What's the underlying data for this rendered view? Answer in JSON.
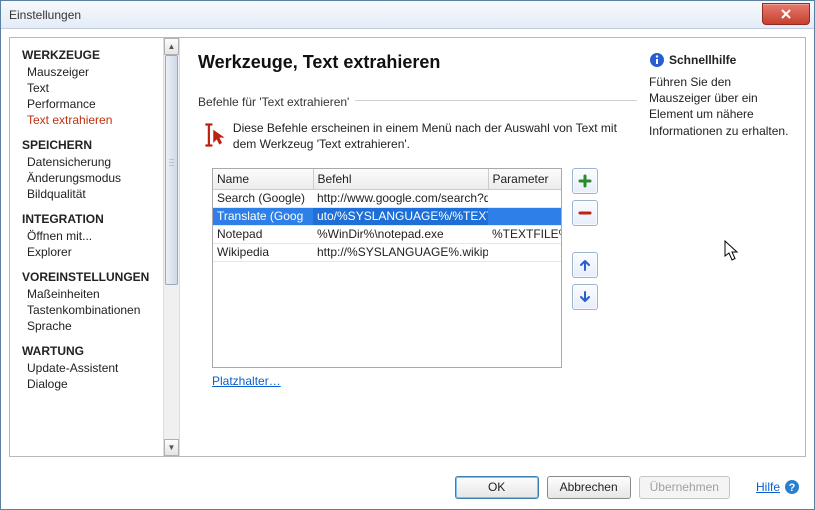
{
  "window": {
    "title": "Einstellungen"
  },
  "sidebar": {
    "groups": [
      {
        "header": "WERKZEUGE",
        "items": [
          "Mauszeiger",
          "Text",
          "Performance",
          "Text extrahieren"
        ],
        "active_index": 3
      },
      {
        "header": "SPEICHERN",
        "items": [
          "Datensicherung",
          "Änderungsmodus",
          "Bildqualität"
        ]
      },
      {
        "header": "INTEGRATION",
        "items": [
          "Öffnen mit...",
          "Explorer"
        ]
      },
      {
        "header": "VOREINSTELLUNGEN",
        "items": [
          "Maßeinheiten",
          "Tastenkombinationen",
          "Sprache"
        ]
      },
      {
        "header": "WARTUNG",
        "items": [
          "Update-Assistent",
          "Dialoge"
        ]
      }
    ]
  },
  "page": {
    "heading": "Werkzeuge, Text extrahieren",
    "fieldset_label": "Befehle für 'Text extrahieren'",
    "description": "Diese Befehle erscheinen in einem Menü nach der Auswahl von Text mit dem Werkzeug 'Text extrahieren'.",
    "table": {
      "columns": [
        "Name",
        "Befehl",
        "Parameter"
      ],
      "rows": [
        {
          "name": "Search (Google)",
          "befehl": "http://www.google.com/search?q",
          "param": ""
        },
        {
          "name": "Translate (Goog",
          "befehl": "uto/%SYSLANGUAGE%/%TEXT%",
          "param": ""
        },
        {
          "name": "Notepad",
          "befehl": "%WinDir%\\notepad.exe",
          "param": "%TEXTFILE%"
        },
        {
          "name": "Wikipedia",
          "befehl": "http://%SYSLANGUAGE%.wikipec",
          "param": ""
        }
      ],
      "selected_index": 1
    },
    "placeholder_link": "Platzhalter…"
  },
  "quickhelp": {
    "title": "Schnellhilfe",
    "text": "Führen Sie den Mauszeiger über ein Element um nähere Informationen zu erhalten."
  },
  "buttons": {
    "ok": "OK",
    "cancel": "Abbrechen",
    "apply": "Übernehmen",
    "help": "Hilfe"
  }
}
